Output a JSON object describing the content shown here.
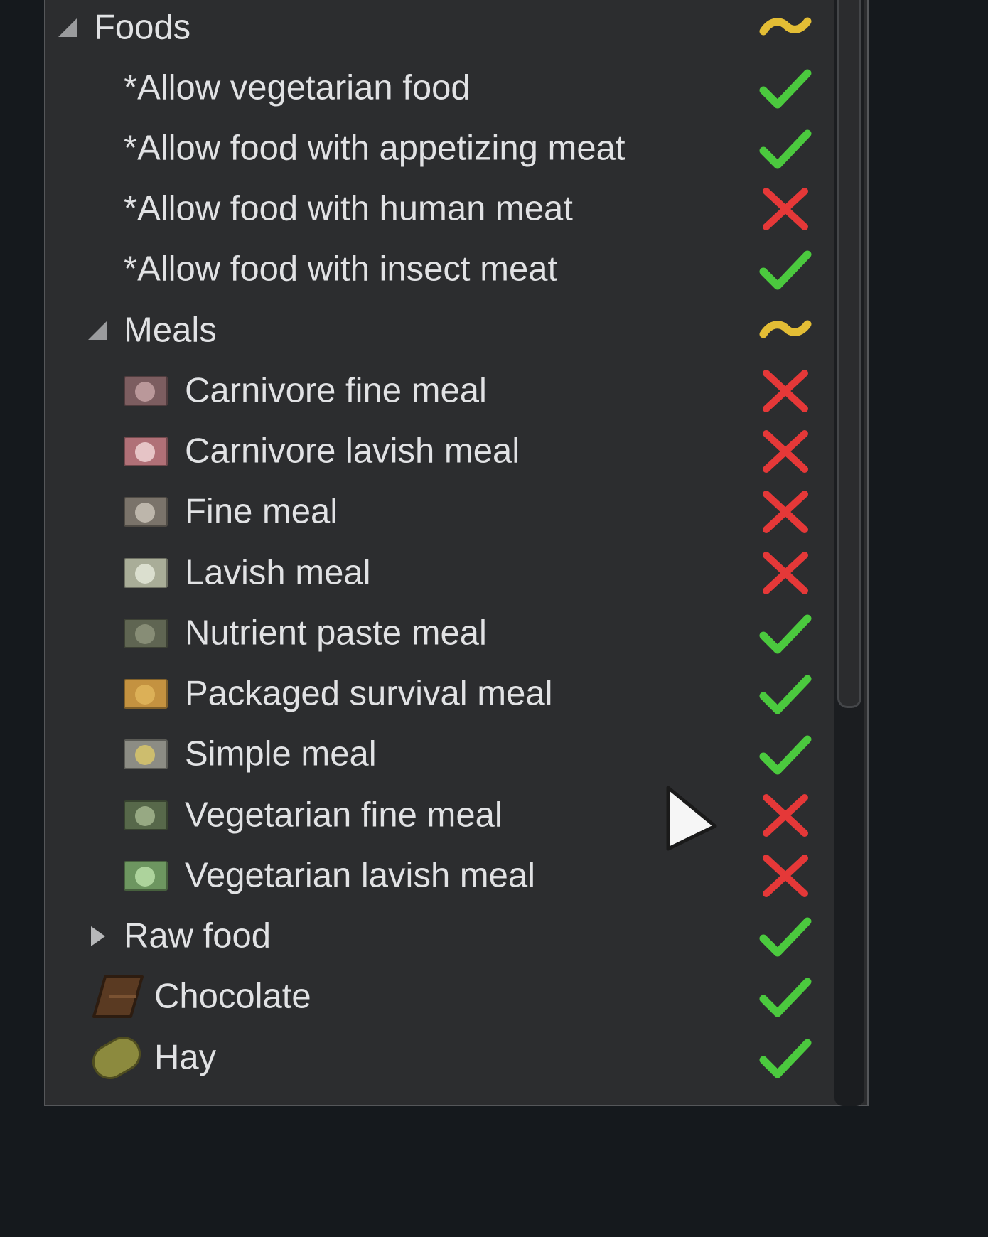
{
  "tree": {
    "rows": [
      {
        "label": "Foods",
        "level": 0,
        "expander": "expanded",
        "icon": null,
        "state": "partial"
      },
      {
        "label": "*Allow vegetarian food",
        "level": 1,
        "expander": null,
        "icon": null,
        "state": "allowed"
      },
      {
        "label": "*Allow food with appetizing meat",
        "level": 1,
        "expander": null,
        "icon": null,
        "state": "allowed"
      },
      {
        "label": "*Allow food with human meat",
        "level": 1,
        "expander": null,
        "icon": null,
        "state": "disallowed"
      },
      {
        "label": "*Allow food with insect meat",
        "level": 1,
        "expander": null,
        "icon": null,
        "state": "allowed"
      },
      {
        "label": "Meals",
        "level": 1,
        "expander": "expanded",
        "icon": null,
        "state": "partial"
      },
      {
        "label": "Carnivore fine meal",
        "level": 2,
        "expander": null,
        "icon": "carnivore-fine-meal-icon",
        "state": "disallowed"
      },
      {
        "label": "Carnivore lavish meal",
        "level": 2,
        "expander": null,
        "icon": "carnivore-lavish-meal-icon",
        "state": "disallowed"
      },
      {
        "label": "Fine meal",
        "level": 2,
        "expander": null,
        "icon": "fine-meal-icon",
        "state": "disallowed"
      },
      {
        "label": "Lavish meal",
        "level": 2,
        "expander": null,
        "icon": "lavish-meal-icon",
        "state": "disallowed"
      },
      {
        "label": "Nutrient paste meal",
        "level": 2,
        "expander": null,
        "icon": "nutrient-paste-meal-icon",
        "state": "allowed"
      },
      {
        "label": "Packaged survival meal",
        "level": 2,
        "expander": null,
        "icon": "packaged-survival-meal-icon",
        "state": "allowed"
      },
      {
        "label": "Simple meal",
        "level": 2,
        "expander": null,
        "icon": "simple-meal-icon",
        "state": "allowed"
      },
      {
        "label": "Vegetarian fine meal",
        "level": 2,
        "expander": null,
        "icon": "vegetarian-fine-meal-icon",
        "state": "disallowed"
      },
      {
        "label": "Vegetarian lavish meal",
        "level": 2,
        "expander": null,
        "icon": "vegetarian-lavish-meal-icon",
        "state": "disallowed"
      },
      {
        "label": "Raw food",
        "level": 1,
        "expander": "collapsed",
        "icon": null,
        "state": "allowed"
      },
      {
        "label": "Chocolate",
        "level": 1,
        "expander": null,
        "icon": "chocolate-icon",
        "state": "allowed"
      },
      {
        "label": "Hay",
        "level": 1,
        "expander": null,
        "icon": "hay-icon",
        "state": "allowed"
      }
    ]
  },
  "colors": {
    "allowed": "#4bc93e",
    "disallowed": "#e53838",
    "partial": "#e3bd35",
    "text": "#e1e2e4",
    "panel": "#2c2d2f",
    "background": "#15191d"
  },
  "icon_colors": {
    "carnivore-fine-meal-icon": [
      "#7c5d60",
      "#c5a2a5"
    ],
    "carnivore-lavish-meal-icon": [
      "#b07077",
      "#f0d2d4"
    ],
    "fine-meal-icon": [
      "#7a736a",
      "#c9c2b6"
    ],
    "lavish-meal-icon": [
      "#a9ad98",
      "#e4e7d8"
    ],
    "nutrient-paste-meal-icon": [
      "#5f6552",
      "#8e947d"
    ],
    "packaged-survival-meal-icon": [
      "#c49240",
      "#e1b55c"
    ],
    "simple-meal-icon": [
      "#8c8c84",
      "#d8c56a"
    ],
    "vegetarian-fine-meal-icon": [
      "#57684a",
      "#a2b58d"
    ],
    "vegetarian-lavish-meal-icon": [
      "#6d9660",
      "#b9dea7"
    ]
  }
}
